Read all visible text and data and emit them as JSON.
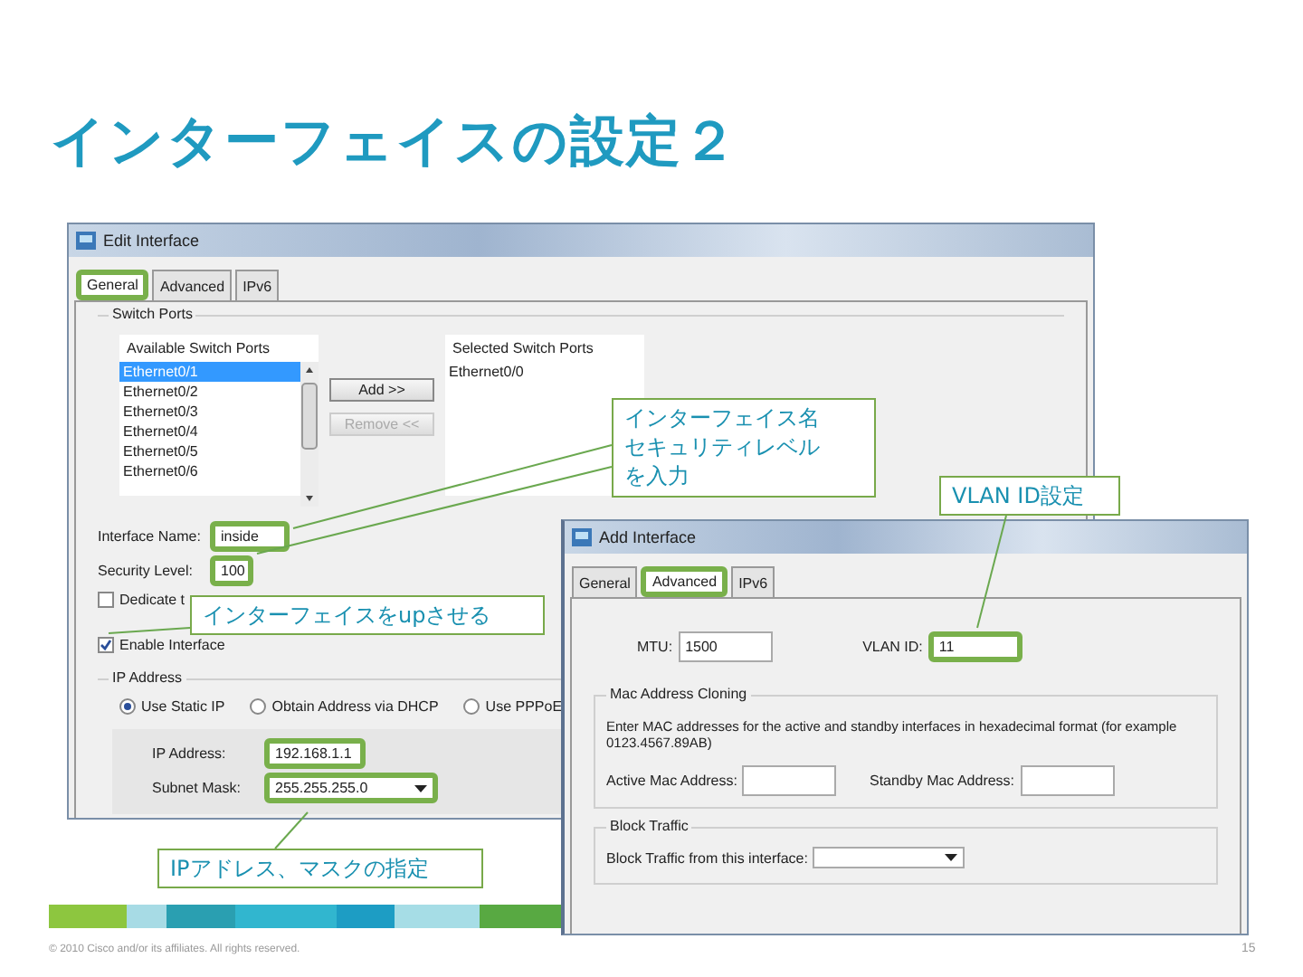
{
  "slide": {
    "title": "インターフェイスの設定２",
    "footer": "© 2010 Cisco and/or its affiliates. All rights reserved.",
    "page_number": "15"
  },
  "edit_window": {
    "title": "Edit Interface",
    "tabs": [
      {
        "label": "General",
        "selected": true,
        "highlighted": true
      },
      {
        "label": "Advanced",
        "selected": false,
        "highlighted": false
      },
      {
        "label": "IPv6",
        "selected": false,
        "highlighted": false
      }
    ],
    "switch_ports": {
      "group_label": "Switch Ports",
      "available_header": "Available Switch Ports",
      "available": [
        {
          "label": "Ethernet0/1",
          "selected": true
        },
        {
          "label": "Ethernet0/2",
          "selected": false
        },
        {
          "label": "Ethernet0/3",
          "selected": false
        },
        {
          "label": "Ethernet0/4",
          "selected": false
        },
        {
          "label": "Ethernet0/5",
          "selected": false
        },
        {
          "label": "Ethernet0/6",
          "selected": false
        }
      ],
      "add_button": {
        "label": "Add >>",
        "disabled": false
      },
      "remove_button": {
        "label": "Remove <<",
        "disabled": true
      },
      "selected_header": "Selected Switch Ports",
      "selected_ports": [
        "Ethernet0/0"
      ]
    },
    "fields": [
      {
        "label": "Interface Name:",
        "value": "inside",
        "highlighted": true
      },
      {
        "label": "Security Level:",
        "value": "100",
        "highlighted": true
      }
    ],
    "checkboxes": [
      {
        "label": "Dedicate t",
        "checked": false
      },
      {
        "label": "Enable Interface",
        "checked": true
      }
    ],
    "ip_group": "IP Address",
    "ip_modes": [
      {
        "label": "Use Static IP",
        "selected": true
      },
      {
        "label": "Obtain Address via DHCP",
        "selected": false
      },
      {
        "label": "Use PPPoE",
        "selected": false
      }
    ],
    "ip_fields": [
      {
        "kind": "text",
        "label": "IP Address:",
        "value": "192.168.1.1",
        "highlighted": true
      },
      {
        "kind": "dropdown",
        "label": "Subnet Mask:",
        "value": "255.255.255.0",
        "highlighted": true
      }
    ]
  },
  "add_window": {
    "title": "Add Interface",
    "tabs": [
      {
        "label": "General",
        "selected": false,
        "highlighted": false
      },
      {
        "label": "Advanced",
        "selected": true,
        "highlighted": true
      },
      {
        "label": "IPv6",
        "selected": false,
        "highlighted": false
      }
    ],
    "fields": [
      {
        "label": "MTU:",
        "value": "1500",
        "highlighted": false
      },
      {
        "label": "VLAN ID:",
        "value": "11",
        "highlighted": true
      }
    ],
    "mac_group": {
      "label": "Mac Address Cloning",
      "description": "Enter MAC addresses for the active and standby interfaces in hexadecimal format (for example 0123.4567.89AB)",
      "fields": [
        {
          "label": "Active Mac Address:"
        },
        {
          "label": "Standby Mac Address:"
        }
      ]
    },
    "block_group": {
      "label": "Block Traffic",
      "field_label": "Block Traffic from this interface:"
    }
  },
  "callouts": [
    {
      "lines": [
        "インターフェイス名",
        "セキュリティレベル",
        "を入力"
      ]
    },
    {
      "lines": [
        "インターフェイスをupさせる"
      ]
    },
    {
      "lines": [
        "VLAN ID設定"
      ]
    },
    {
      "lines": [
        "IPアドレス、マスクの指定"
      ]
    }
  ]
}
